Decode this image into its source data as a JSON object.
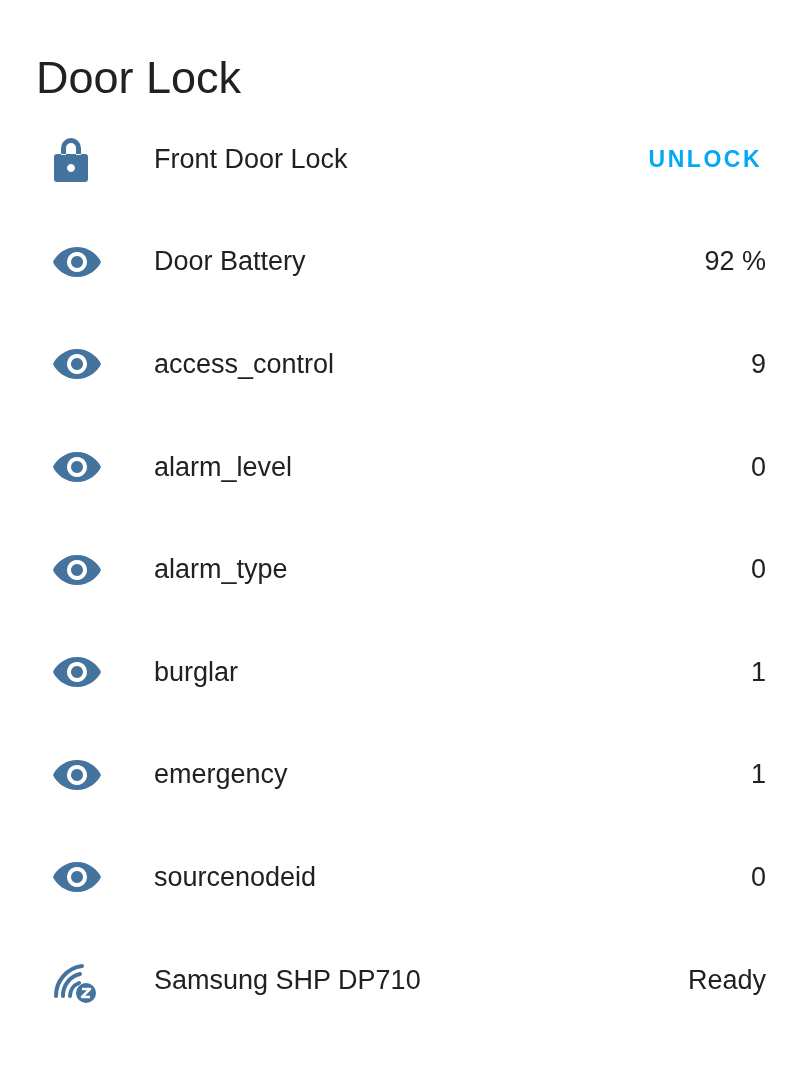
{
  "title": "Door Lock",
  "rows": [
    {
      "kind": "lock",
      "name": "Front Door Lock",
      "action": "UNLOCK"
    },
    {
      "kind": "sensor",
      "name": "Door Battery",
      "value": "92 %"
    },
    {
      "kind": "sensor",
      "name": "access_control",
      "value": "9"
    },
    {
      "kind": "sensor",
      "name": "alarm_level",
      "value": "0"
    },
    {
      "kind": "sensor",
      "name": "alarm_type",
      "value": "0"
    },
    {
      "kind": "sensor",
      "name": "burglar",
      "value": "1"
    },
    {
      "kind": "sensor",
      "name": "emergency",
      "value": "1"
    },
    {
      "kind": "sensor",
      "name": "sourcenodeid",
      "value": "0"
    },
    {
      "kind": "zwave",
      "name": "Samsung SHP DP710",
      "value": "Ready"
    }
  ]
}
